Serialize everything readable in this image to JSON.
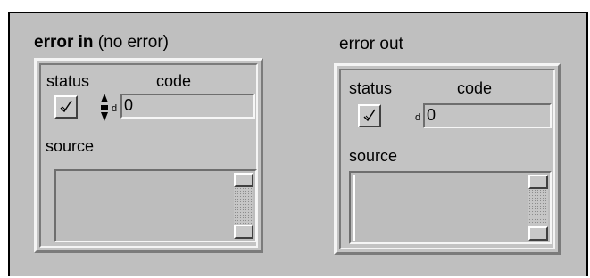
{
  "error_in": {
    "label_bold": "error in",
    "label_rest": " (no error)",
    "status_label": "status",
    "code_label": "code",
    "code_value": "0",
    "numeric_glyph": "d",
    "source_label": "source",
    "source_value": "",
    "status_checked": true
  },
  "error_out": {
    "label": "error out",
    "status_label": "status",
    "code_label": "code",
    "code_value": "0",
    "numeric_glyph": "d",
    "source_label": "source",
    "source_value": "",
    "status_checked": true
  },
  "icons": {
    "status": "checkmark-icon",
    "increment": "arrow-up-icon",
    "decrement": "arrow-down-icon"
  },
  "colors": {
    "panel_background": "#bfbfbf",
    "panel_border": "#000000"
  }
}
